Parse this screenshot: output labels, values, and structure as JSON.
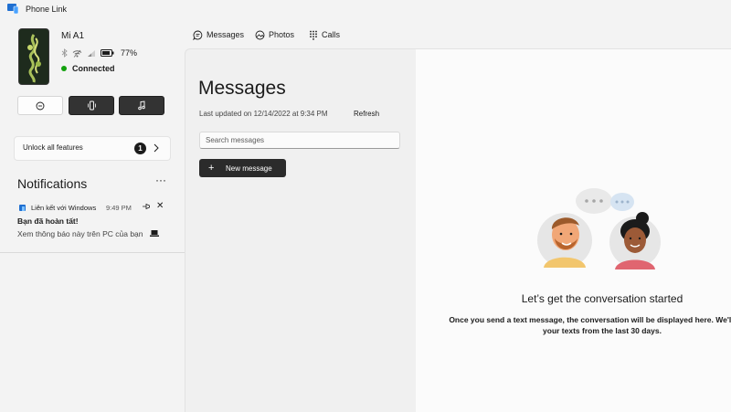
{
  "window": {
    "title": "Phone Link"
  },
  "device": {
    "name": "Mi A1",
    "battery": "77%",
    "connection": "Connected"
  },
  "quick_actions": [
    {
      "icon": "do-not-disturb-icon"
    },
    {
      "icon": "vibrate-icon"
    },
    {
      "icon": "music-icon"
    }
  ],
  "unlock": {
    "label": "Unlock all features",
    "badge": "1"
  },
  "notifications": {
    "title": "Notifications",
    "more": "···",
    "items": [
      {
        "app": "Liên kết với Windows",
        "time": "9:49 PM",
        "title": "Bạn đã hoàn tất!",
        "body": "Xem thông báo này trên PC của bạn"
      }
    ]
  },
  "tabs": [
    {
      "label": "Messages",
      "icon": "messages-icon"
    },
    {
      "label": "Photos",
      "icon": "photos-icon"
    },
    {
      "label": "Calls",
      "icon": "dialpad-icon"
    }
  ],
  "messages_pane": {
    "title": "Messages",
    "last_updated": "Last updated on 12/14/2022 at 9:34 PM",
    "refresh": "Refresh",
    "search_placeholder": "Search messages",
    "new_message": "New message"
  },
  "conversation": {
    "empty_title": "Let’s get the conversation started",
    "empty_desc_line1": "Once you send a text message, the conversation will be displayed here. We'll show",
    "empty_desc_line2": "your texts from the last 30 days."
  },
  "colors": {
    "connected": "#13a10e",
    "dark_button": "#333333",
    "pane_background": "#f0f0f0"
  }
}
